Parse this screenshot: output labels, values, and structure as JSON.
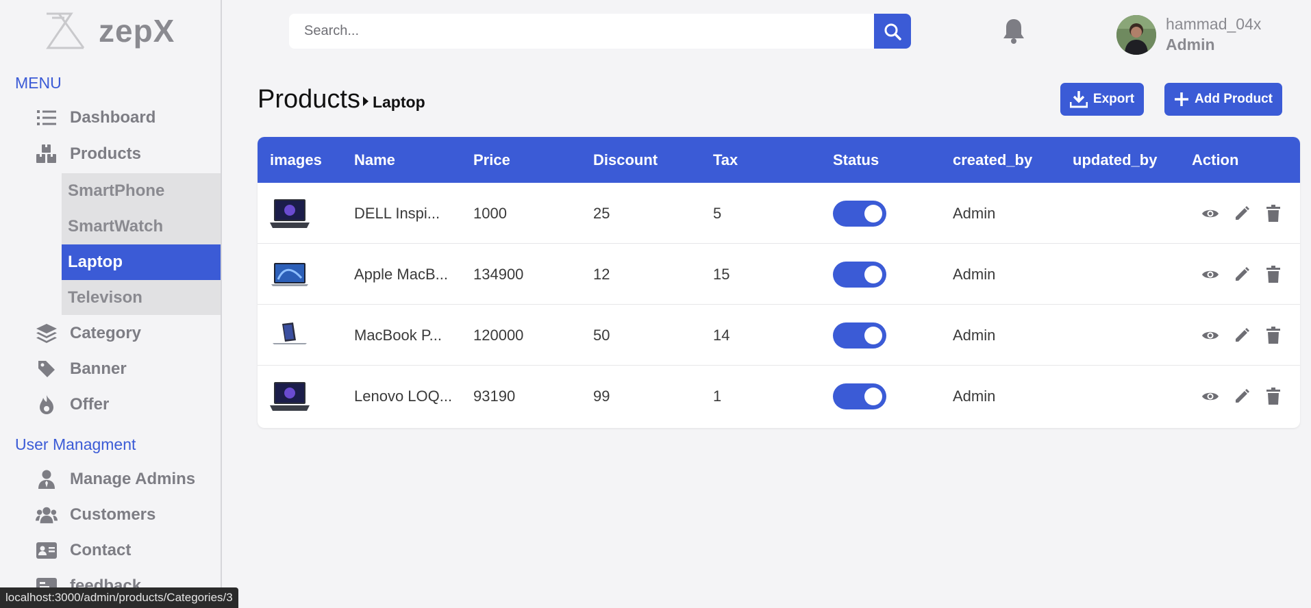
{
  "brand": {
    "name": "zepX"
  },
  "sidebar": {
    "menu_heading": "MENU",
    "items": [
      {
        "label": "Dashboard",
        "icon": "list-icon"
      },
      {
        "label": "Products",
        "icon": "boxes-icon"
      },
      {
        "label": "Category",
        "icon": "layers-icon"
      },
      {
        "label": "Banner",
        "icon": "tag-icon"
      },
      {
        "label": "Offer",
        "icon": "fire-icon"
      }
    ],
    "sub_items": [
      {
        "label": "SmartPhone",
        "active": false
      },
      {
        "label": "SmartWatch",
        "active": false
      },
      {
        "label": "Laptop",
        "active": true
      },
      {
        "label": "Televison",
        "active": false
      }
    ],
    "user_heading": "User Managment",
    "user_items": [
      {
        "label": "Manage Admins",
        "icon": "user-tie-icon"
      },
      {
        "label": "Customers",
        "icon": "users-icon"
      },
      {
        "label": "Contact",
        "icon": "id-card-icon"
      },
      {
        "label": "feedback",
        "icon": "feedback-icon"
      }
    ]
  },
  "header": {
    "search_placeholder": "Search...",
    "user_name": "hammad_04x",
    "user_role": "Admin"
  },
  "page": {
    "title": "Products",
    "subtitle": "Laptop",
    "export_label": "Export",
    "add_label": "Add Product"
  },
  "table": {
    "columns": [
      "images",
      "Name",
      "Price",
      "Discount",
      "Tax",
      "Status",
      "created_by",
      "updated_by",
      "Action"
    ],
    "rows": [
      {
        "name": "DELL Inspi...",
        "price": "1000",
        "discount": "25",
        "tax": "5",
        "status": true,
        "created_by": "Admin",
        "updated_by": ""
      },
      {
        "name": "Apple MacB...",
        "price": "134900",
        "discount": "12",
        "tax": "15",
        "status": true,
        "created_by": "Admin",
        "updated_by": ""
      },
      {
        "name": "MacBook P...",
        "price": "120000",
        "discount": "50",
        "tax": "14",
        "status": true,
        "created_by": "Admin",
        "updated_by": ""
      },
      {
        "name": "Lenovo LOQ...",
        "price": "93190",
        "discount": "99",
        "tax": "1",
        "status": true,
        "created_by": "Admin",
        "updated_by": ""
      }
    ]
  },
  "statusbar": {
    "url": "localhost:3000/admin/products/Categories/3"
  },
  "colors": {
    "accent": "#3b5bd6",
    "muted": "#8a8a90"
  }
}
